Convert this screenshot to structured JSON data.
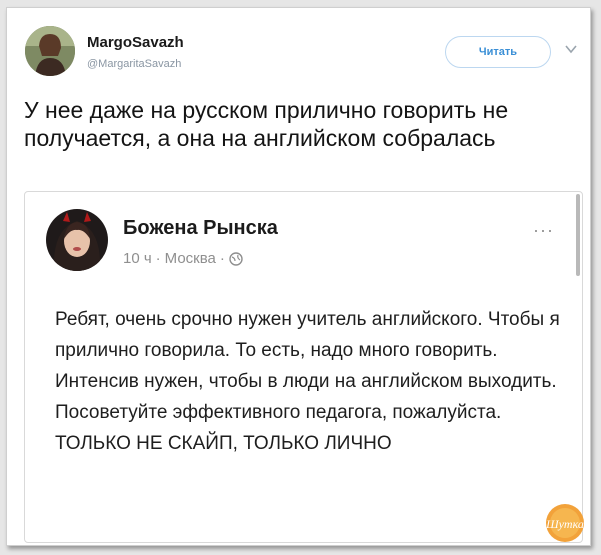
{
  "tweet": {
    "author_name": "MargoSavazh",
    "author_handle": "@MargaritaSavazh",
    "follow_label": "Читать",
    "text": "У нее даже на русском прилично говорить не получается, а она на английском собралась"
  },
  "embedded_post": {
    "author_name": "Божена Рынска",
    "meta_time": "10 ч",
    "meta_sep": "·",
    "meta_location": "Москва",
    "more_label": "···",
    "text": "Ребят, очень срочно нужен учитель английского. Чтобы я прилично говорила. То есть, надо много говорить. Интенсив нужен, чтобы в люди на английском выходить. Посоветуйте эффективного педагога, пожалуйста. ТОЛЬКО НЕ СКАЙП, ТОЛЬКО ЛИЧНО"
  },
  "watermark": {
    "text": "Шутка"
  },
  "icons": {
    "chevron": "chevron-down-icon",
    "globe": "globe-icon"
  },
  "colors": {
    "follow_text": "#3a8fd6",
    "follow_border": "#bcd7f0",
    "handle": "#8a96a3",
    "watermark": "#f2a23a"
  }
}
